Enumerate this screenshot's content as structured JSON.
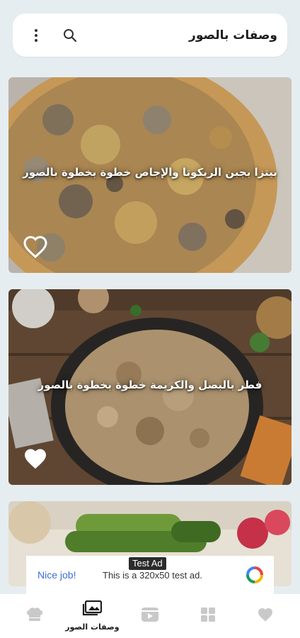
{
  "header": {
    "title": "وصفات بالصور",
    "search_icon": "search-icon",
    "more_icon": "more-vert-icon"
  },
  "recipes": [
    {
      "title": "بيتزا بجبن الريكوتا والإجاص خطوة بخطوة بالصور",
      "favorite": false
    },
    {
      "title": "فطر بالبصل والكريمة خطوة بخطوة بالصور",
      "favorite": true
    }
  ],
  "ad": {
    "badge": "Test Ad",
    "nice": "Nice job!",
    "text": "This is a 320x50 test ad."
  },
  "bottom_nav": {
    "items": [
      {
        "icon": "chef-hat-icon",
        "label": ""
      },
      {
        "icon": "photo-gallery-icon",
        "label": "وصفات الصور",
        "active": true
      },
      {
        "icon": "video-icon",
        "label": ""
      },
      {
        "icon": "grid-icon",
        "label": ""
      },
      {
        "icon": "heart-icon",
        "label": ""
      }
    ]
  },
  "colors": {
    "background": "#e6edf0",
    "surface": "#ffffff",
    "inactive_icon": "#c9c9c9",
    "active_icon": "#1d1d1d",
    "ad_link": "#3a6fd8"
  }
}
